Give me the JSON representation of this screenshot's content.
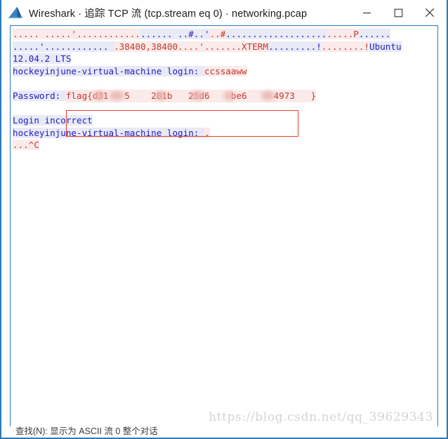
{
  "window": {
    "title": "Wireshark · 追踪 TCP 流 (tcp.stream eq 0) · networking.pcap",
    "app_icon_name": "wireshark-shark-fin-logo",
    "accent_color": "#2a7ab9",
    "minimize_label": "—",
    "maximize_label": "□",
    "close_label": "✕"
  },
  "stream": {
    "colors": {
      "client_text": "#c0392b",
      "client_background": "#fbeaea",
      "server_text": "#1f1fbf",
      "server_background": "#e9e9f7",
      "highlight_box_border": "#e2402c"
    },
    "lines": [
      {
        "id": "line-1",
        "segments": [
          {
            "dir": "client",
            "text": "..... .....'............"
          },
          {
            "dir": "server",
            "text": "...... ..#..'"
          },
          {
            "dir": "client",
            "text": "..#"
          },
          {
            "dir": "server",
            "text": "..................."
          },
          {
            "dir": "client",
            "text": ".....P"
          },
          {
            "dir": "server",
            "text": "......"
          }
        ]
      },
      {
        "id": "line-2",
        "segments": [
          {
            "dir": "server",
            "text": ".....'............ "
          },
          {
            "dir": "client",
            "text": ".38400,38400....'.......XTERM"
          },
          {
            "dir": "server",
            "text": ".........!"
          },
          {
            "dir": "client",
            "text": "........!"
          },
          {
            "dir": "server",
            "text": "Ubuntu"
          }
        ]
      },
      {
        "id": "line-3",
        "segments": [
          {
            "dir": "server",
            "text": "12.04.2 LTS"
          }
        ]
      },
      {
        "id": "line-4",
        "segments": [
          {
            "dir": "server",
            "text": "hockeyinjune-virtual-machine login: "
          },
          {
            "dir": "client",
            "text": "ccssaaww"
          }
        ]
      },
      {
        "id": "line-5",
        "segments": []
      },
      {
        "id": "line-6-password",
        "segments": [
          {
            "dir": "server",
            "text": "Password: "
          },
          {
            "dir": "client",
            "text": "flag{d31   5    281b   25d6    be6     4973   }"
          }
        ]
      },
      {
        "id": "line-7",
        "segments": []
      },
      {
        "id": "line-8",
        "segments": [
          {
            "dir": "server",
            "text": "Login incorrect"
          }
        ]
      },
      {
        "id": "line-9",
        "segments": [
          {
            "dir": "server",
            "text": "hockeyinjune-virtual-machine login: "
          },
          {
            "dir": "client",
            "text": "."
          }
        ]
      },
      {
        "id": "line-10",
        "segments": [
          {
            "dir": "client",
            "text": "...^C"
          }
        ]
      }
    ],
    "redaction_note": "Portions of the flag string are blurred out in the screenshot."
  },
  "watermark": {
    "text": "https://blog.csdn.net/qq_39629343"
  },
  "bottom_strip": {
    "clipped_text": "查找(N):  显示为 ASCII   流 0  整个对话"
  }
}
